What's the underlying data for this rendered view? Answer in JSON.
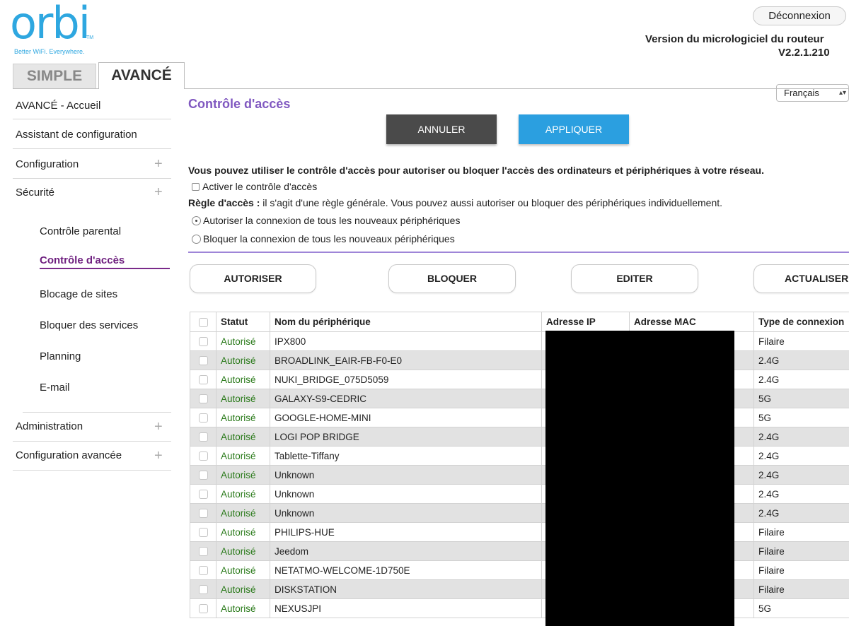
{
  "brand": {
    "logo": "orbi",
    "tm": "TM",
    "tagline": "Better WiFi. Everywhere."
  },
  "header": {
    "logout_label": "Déconnexion",
    "firmware_label": "Version du micrologiciel du routeur",
    "firmware_version": "V2.2.1.210",
    "language": "Français"
  },
  "tabs": {
    "simple": "SIMPLE",
    "advanced": "AVANCÉ"
  },
  "nav": {
    "home": "AVANCÉ - Accueil",
    "wizard": "Assistant de configuration",
    "config": "Configuration",
    "security": "Sécurité",
    "security_sub": {
      "parental": "Contrôle parental",
      "access": "Contrôle d'accès",
      "block_sites": "Blocage de sites",
      "block_services": "Bloquer des services",
      "schedule": "Planning",
      "email": "E-mail"
    },
    "admin": "Administration",
    "advanced_config": "Configuration avancée",
    "plus": "+"
  },
  "main": {
    "title": "Contrôle d'accès",
    "cancel_label": "ANNULER",
    "apply_label": "APPLIQUER",
    "intro": "Vous pouvez utiliser le contrôle d'accès pour autoriser ou bloquer l'accès des ordinateurs et périphériques à votre réseau.",
    "enable_label": "Activer le contrôle d'accès",
    "rule_label": "Règle d'accès :",
    "rule_text": " il s'agit d'une règle générale. Vous pouvez aussi autoriser ou bloquer des périphériques individuellement.",
    "allow_all": "Autoriser la connexion de tous les nouveaux périphériques",
    "block_all": "Bloquer la connexion de tous les nouveaux périphériques",
    "actions": {
      "allow": "AUTORISER",
      "block": "BLOQUER",
      "edit": "EDITER",
      "refresh": "ACTUALISER"
    }
  },
  "table": {
    "headers": [
      "Statut",
      "Nom du périphérique",
      "Adresse IP",
      "Adresse MAC",
      "Type de connexion"
    ],
    "rows": [
      {
        "status": "Autorisé",
        "name": "IPX800",
        "type": "Filaire"
      },
      {
        "status": "Autorisé",
        "name": "BROADLINK_EAIR-FB-F0-E0",
        "type": "2.4G"
      },
      {
        "status": "Autorisé",
        "name": "NUKI_BRIDGE_075D5059",
        "type": "2.4G"
      },
      {
        "status": "Autorisé",
        "name": "GALAXY-S9-CEDRIC",
        "type": "5G"
      },
      {
        "status": "Autorisé",
        "name": "GOOGLE-HOME-MINI",
        "type": "5G"
      },
      {
        "status": "Autorisé",
        "name": "LOGI POP BRIDGE",
        "type": "2.4G"
      },
      {
        "status": "Autorisé",
        "name": "Tablette-Tiffany",
        "type": "2.4G"
      },
      {
        "status": "Autorisé",
        "name": "Unknown",
        "type": "2.4G"
      },
      {
        "status": "Autorisé",
        "name": "Unknown",
        "type": "2.4G"
      },
      {
        "status": "Autorisé",
        "name": "Unknown",
        "type": "2.4G"
      },
      {
        "status": "Autorisé",
        "name": "PHILIPS-HUE",
        "type": "Filaire"
      },
      {
        "status": "Autorisé",
        "name": "Jeedom",
        "type": "Filaire"
      },
      {
        "status": "Autorisé",
        "name": "NETATMO-WELCOME-1D750E",
        "type": "Filaire"
      },
      {
        "status": "Autorisé",
        "name": "DISKSTATION",
        "type": "Filaire"
      },
      {
        "status": "Autorisé",
        "name": "NEXUSJPI",
        "type": "5G"
      }
    ]
  },
  "colors": {
    "brand_blue": "#2ea7e0",
    "title_purple": "#8058c0",
    "active_nav": "#6e1f7f",
    "status_green": "#2a7a1a",
    "apply_blue": "#2b9fe0",
    "cancel_dark": "#4a4a4a"
  }
}
